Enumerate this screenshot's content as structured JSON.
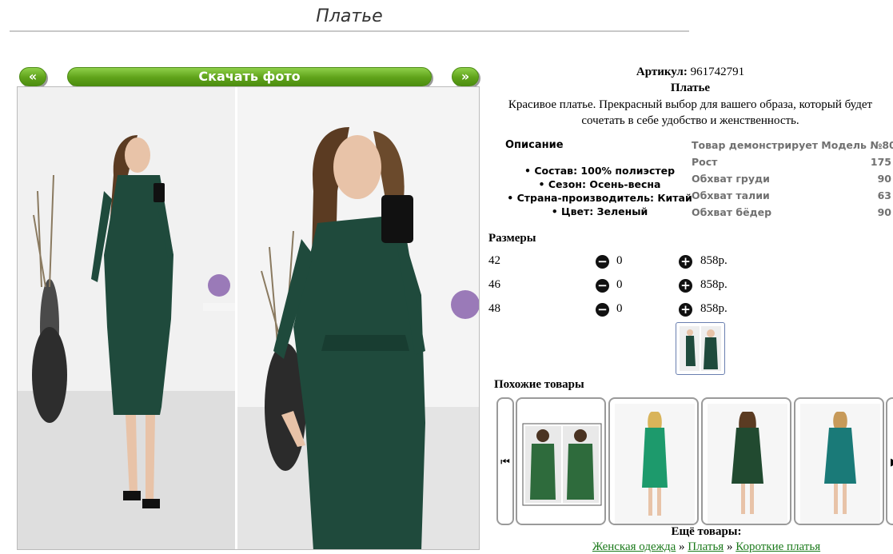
{
  "page": {
    "title": "Платье"
  },
  "gallery": {
    "prev_label": "«",
    "download_label": "Скачать фото",
    "next_label": "»"
  },
  "product": {
    "article_label": "Артикул:",
    "article_value": "961742791",
    "name": "Платье",
    "description": "Красивое платье. Прекрасный выбор для вашего образа, который будет сочетать в себе удобство и женственность."
  },
  "details": {
    "heading": "Описание",
    "properties": [
      "Состав: 100% полиэстер",
      "Сезон: Осень-весна",
      "Страна-производитель: Китай",
      "Цвет: Зеленый"
    ]
  },
  "measurements": [
    {
      "label": "Товар демонстрирует Модель №80",
      "value": ""
    },
    {
      "label": "Рост",
      "value": "175"
    },
    {
      "label": "Обхват груди",
      "value": "90"
    },
    {
      "label": "Обхват талии",
      "value": "63"
    },
    {
      "label": "Обхват бёдер",
      "value": "90"
    }
  ],
  "sizes": {
    "heading": "Размеры",
    "rows": [
      {
        "size": "42",
        "qty": "0",
        "price": "858р."
      },
      {
        "size": "46",
        "qty": "0",
        "price": "858р."
      },
      {
        "size": "48",
        "qty": "0",
        "price": "858р."
      }
    ]
  },
  "similar": {
    "heading": "Похожие товары",
    "first_icon": "skip-back-icon",
    "next_icon": "skip-forward-icon"
  },
  "more": {
    "heading": "Ещё товары:",
    "breadcrumb": [
      "Женская одежда",
      "Платья",
      "Короткие платья"
    ],
    "separator": "»"
  },
  "colors": {
    "accent_green": "#5fa21a",
    "dress_green": "#1f4a3c",
    "link_green": "#1b7a1b"
  }
}
